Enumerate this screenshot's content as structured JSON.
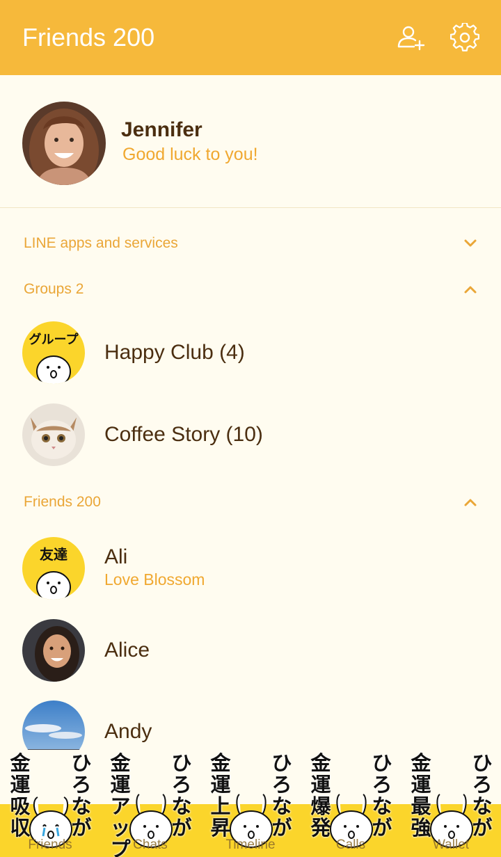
{
  "header": {
    "title": "Friends 200",
    "add_friend_icon": "add-friend-icon",
    "settings_icon": "gear-icon"
  },
  "profile": {
    "name": "Jennifer",
    "status": "Good luck to you!"
  },
  "sections": {
    "apps": {
      "label": "LINE apps and services",
      "state": "collapsed"
    },
    "groups": {
      "label": "Groups 2",
      "state": "expanded"
    },
    "friends": {
      "label": "Friends 200",
      "state": "expanded"
    }
  },
  "groups": [
    {
      "name": "Happy Club (4)",
      "avatar_text": "グループ"
    },
    {
      "name": "Coffee Story (10)"
    }
  ],
  "friends": [
    {
      "name": "Ali",
      "status": "Love Blossom",
      "avatar_text": "友達"
    },
    {
      "name": "Alice"
    },
    {
      "name": "Andy"
    }
  ],
  "tabs": [
    {
      "label": "Friends",
      "left_text": "金運吸収",
      "right_text": "ひろなが"
    },
    {
      "label": "Chats",
      "left_text": "金運アップ",
      "right_text": "ひろなが"
    },
    {
      "label": "Timeline",
      "left_text": "金運上昇",
      "right_text": "ひろなが"
    },
    {
      "label": "Calls",
      "left_text": "金運爆発",
      "right_text": "ひろなが"
    },
    {
      "label": "Wallet",
      "left_text": "金運最強",
      "right_text": "ひろなが"
    }
  ],
  "colors": {
    "header": "#f6b93b",
    "accent": "#f0a830",
    "text": "#4b2e10",
    "background": "#fffcf0",
    "tab_yellow": "#fbd52b"
  }
}
